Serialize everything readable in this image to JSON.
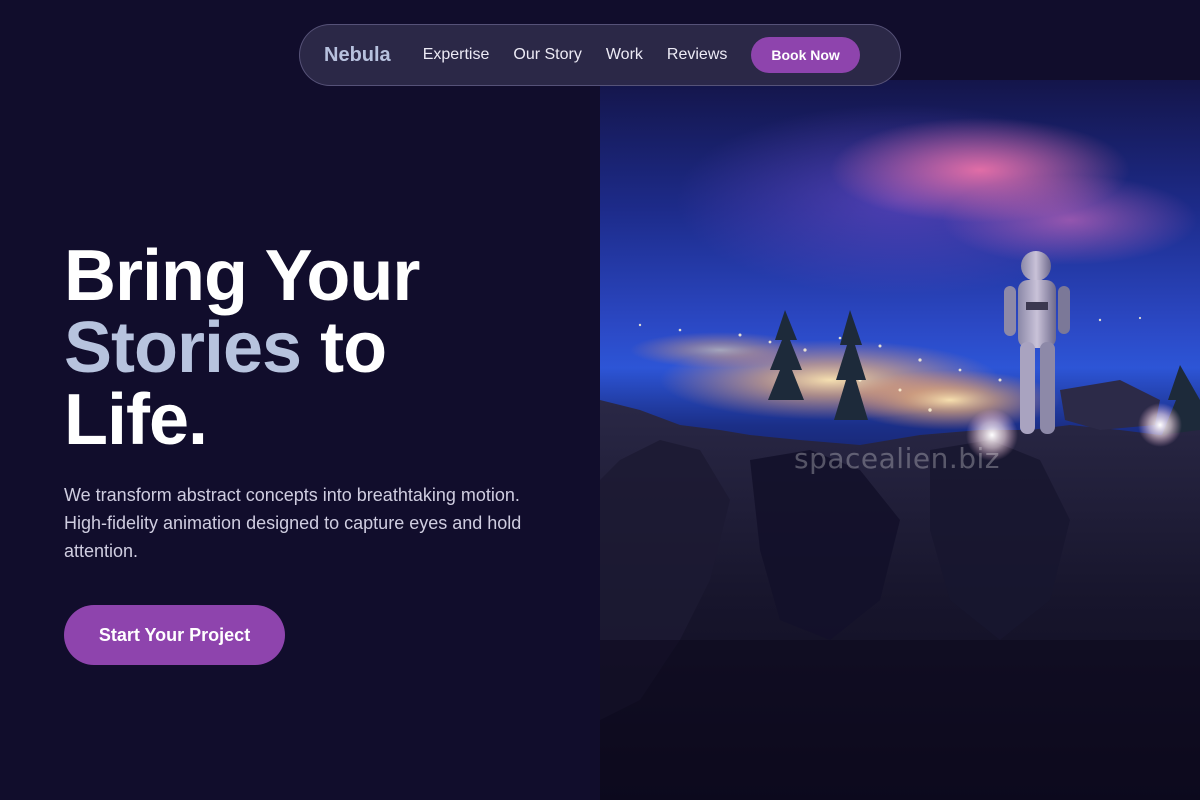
{
  "nav": {
    "brand": "Nebula",
    "links": [
      "Expertise",
      "Our Story",
      "Work",
      "Reviews"
    ],
    "book_label": "Book Now"
  },
  "hero": {
    "headline_line1": "Bring Your",
    "headline_accent": "Stories",
    "headline_after_accent": " to",
    "headline_line3": "Life.",
    "subtext": "We transform abstract concepts into breathtaking motion. High-fidelity animation designed to capture eyes and hold attention.",
    "cta_label": "Start Your Project"
  },
  "image": {
    "watermark": "spacealien.biz",
    "subject": "astronaut standing on cliff overlooking city lights at night"
  },
  "colors": {
    "background": "#110d2c",
    "accent": "#8e44ad",
    "headline_accent": "#b7c3de",
    "brand": "#b7c1de"
  }
}
